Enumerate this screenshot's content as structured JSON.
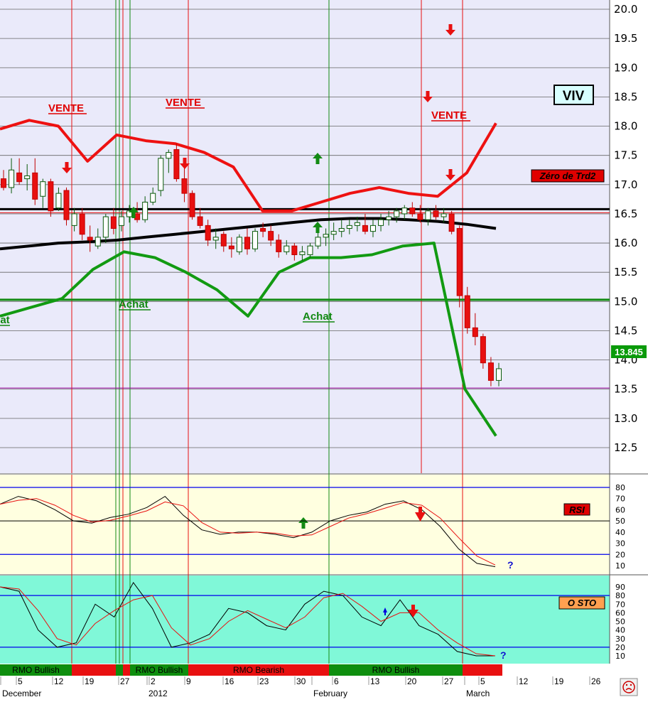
{
  "ticker": "VIV",
  "price_box": "13.845",
  "labels": {
    "vente": "VENTE",
    "achat": "Achat",
    "zero_trd2": "Zéro de Trd2",
    "rsi": "RSI",
    "osto": "O STO",
    "question": "?"
  },
  "colors": {
    "bullish": "#138a13",
    "bearish": "#e81010",
    "main_bg": "#eaeafa",
    "rsi_bg": "#ffffe0",
    "sto_bg": "#80f8d8"
  },
  "chart_data": [
    {
      "type": "candlestick",
      "title": "",
      "ylim": [
        12.1,
        20.2
      ],
      "ytick_labels": [
        "20.0",
        "19.5",
        "19.0",
        "18.5",
        "18.0",
        "17.5",
        "17.0",
        "16.5",
        "16.0",
        "15.5",
        "15.0",
        "14.5",
        "14.0",
        "13.5",
        "13.0",
        "12.5"
      ],
      "horizontal_levels": {
        "zero_trd2": 16.58,
        "support": 15.03,
        "low": 13.52
      },
      "candles": [
        [
          17.1,
          17.25,
          16.9,
          16.95
        ],
        [
          16.95,
          17.45,
          16.85,
          17.25
        ],
        [
          17.2,
          17.45,
          17.0,
          17.05
        ],
        [
          17.1,
          17.35,
          16.9,
          17.15
        ],
        [
          17.2,
          17.45,
          16.65,
          16.75
        ],
        [
          16.8,
          17.1,
          16.6,
          17.05
        ],
        [
          17.05,
          17.1,
          16.45,
          16.55
        ],
        [
          16.6,
          16.95,
          16.55,
          16.85
        ],
        [
          16.9,
          16.95,
          16.3,
          16.4
        ],
        [
          16.3,
          16.6,
          16.2,
          16.5
        ],
        [
          16.5,
          16.6,
          16.05,
          16.15
        ],
        [
          16.1,
          16.3,
          15.85,
          16.05
        ],
        [
          15.95,
          16.25,
          15.9,
          16.1
        ],
        [
          16.1,
          16.5,
          16.0,
          16.45
        ],
        [
          16.45,
          16.6,
          16.15,
          16.25
        ],
        [
          16.3,
          16.55,
          16.2,
          16.45
        ],
        [
          16.45,
          16.65,
          16.35,
          16.55
        ],
        [
          16.5,
          16.7,
          16.35,
          16.4
        ],
        [
          16.4,
          16.8,
          16.35,
          16.7
        ],
        [
          16.7,
          16.95,
          16.65,
          16.85
        ],
        [
          16.9,
          17.5,
          16.8,
          17.45
        ],
        [
          17.45,
          17.6,
          17.2,
          17.55
        ],
        [
          17.6,
          17.7,
          17.05,
          17.1
        ],
        [
          17.1,
          17.45,
          16.7,
          16.85
        ],
        [
          16.85,
          16.9,
          16.4,
          16.45
        ],
        [
          16.45,
          16.6,
          16.25,
          16.3
        ],
        [
          16.3,
          16.4,
          15.95,
          16.05
        ],
        [
          16.05,
          16.25,
          15.9,
          16.1
        ],
        [
          16.15,
          16.2,
          15.85,
          15.95
        ],
        [
          15.95,
          16.1,
          15.75,
          15.9
        ],
        [
          15.85,
          16.15,
          15.8,
          16.1
        ],
        [
          16.1,
          16.25,
          15.8,
          15.9
        ],
        [
          15.9,
          16.25,
          15.85,
          16.2
        ],
        [
          16.25,
          16.35,
          16.1,
          16.2
        ],
        [
          16.2,
          16.3,
          15.95,
          16.05
        ],
        [
          16.05,
          16.15,
          15.75,
          15.85
        ],
        [
          15.85,
          16.05,
          15.8,
          15.95
        ],
        [
          15.95,
          16.0,
          15.7,
          15.8
        ],
        [
          15.8,
          15.95,
          15.7,
          15.85
        ],
        [
          15.8,
          16.0,
          15.75,
          15.95
        ],
        [
          15.95,
          16.2,
          15.9,
          16.1
        ],
        [
          16.1,
          16.25,
          15.95,
          16.15
        ],
        [
          16.15,
          16.35,
          16.05,
          16.2
        ],
        [
          16.2,
          16.4,
          16.1,
          16.25
        ],
        [
          16.25,
          16.4,
          16.15,
          16.3
        ],
        [
          16.3,
          16.45,
          16.2,
          16.35
        ],
        [
          16.3,
          16.5,
          16.15,
          16.2
        ],
        [
          16.2,
          16.4,
          16.1,
          16.3
        ],
        [
          16.3,
          16.5,
          16.2,
          16.4
        ],
        [
          16.4,
          16.55,
          16.3,
          16.45
        ],
        [
          16.45,
          16.6,
          16.35,
          16.55
        ],
        [
          16.5,
          16.65,
          16.4,
          16.6
        ],
        [
          16.6,
          16.7,
          16.45,
          16.5
        ],
        [
          16.5,
          16.65,
          16.35,
          16.4
        ],
        [
          16.4,
          16.6,
          16.3,
          16.55
        ],
        [
          16.55,
          16.65,
          16.4,
          16.45
        ],
        [
          16.45,
          16.6,
          16.35,
          16.5
        ],
        [
          16.5,
          16.55,
          16.15,
          16.2
        ],
        [
          16.25,
          16.3,
          14.9,
          15.1
        ],
        [
          15.1,
          15.25,
          14.45,
          14.55
        ],
        [
          14.55,
          14.8,
          14.25,
          14.4
        ],
        [
          14.4,
          14.45,
          13.85,
          13.95
        ],
        [
          13.95,
          14.05,
          13.55,
          13.65
        ],
        [
          13.65,
          13.95,
          13.55,
          13.85
        ]
      ],
      "moving_avg_black": [
        15.9,
        15.95,
        16.0,
        16.02,
        16.05,
        16.1,
        16.15,
        16.2,
        16.25,
        16.3,
        16.35,
        16.4,
        16.42,
        16.42,
        16.4,
        16.37,
        16.32,
        16.25
      ],
      "series": [
        {
          "values": [
            17.95,
            18.1,
            18.0,
            17.4,
            17.85,
            17.75,
            17.7,
            17.55,
            17.3,
            16.55,
            16.55,
            16.7,
            16.85,
            16.95,
            16.85,
            16.8,
            17.2,
            18.05
          ]
        },
        {
          "values": [
            14.75,
            14.9,
            15.05,
            15.55,
            15.85,
            15.75,
            15.5,
            15.2,
            14.75,
            15.5,
            15.75,
            15.75,
            15.8,
            15.95,
            16.0,
            13.5,
            12.7
          ]
        }
      ],
      "signals": {
        "buy": [
          "Achat",
          "Achat"
        ],
        "sell": [
          "VENTE",
          "VENTE",
          "VENTE"
        ]
      }
    },
    {
      "type": "line",
      "title": "RSI",
      "ylim": [
        0,
        90
      ],
      "ytick_labels": [
        "80",
        "70",
        "60",
        "50",
        "40",
        "30",
        "20",
        "10"
      ],
      "reference_lines": [
        80,
        50,
        20
      ],
      "values": [
        65,
        72,
        68,
        60,
        50,
        48,
        53,
        56,
        62,
        72,
        55,
        42,
        38,
        40,
        40,
        38,
        35,
        40,
        50,
        55,
        58,
        65,
        68,
        60,
        45,
        25,
        12,
        9
      ]
    },
    {
      "type": "line",
      "title": "O STO",
      "ylim": [
        0,
        100
      ],
      "ytick_labels": [
        "90",
        "80",
        "70",
        "60",
        "50",
        "40",
        "30",
        "20",
        "10"
      ],
      "reference_lines": [
        80,
        20
      ],
      "values": [
        90,
        85,
        40,
        20,
        25,
        70,
        55,
        95,
        65,
        20,
        25,
        35,
        65,
        60,
        45,
        40,
        70,
        85,
        80,
        55,
        45,
        75,
        45,
        35,
        15,
        10,
        10
      ]
    }
  ],
  "rmo_segments": [
    {
      "label": "RMO Bullish",
      "state": "bullish"
    },
    {
      "label": "",
      "state": "bearish"
    },
    {
      "label": "",
      "state": "bullish"
    },
    {
      "label": "",
      "state": "bearish"
    },
    {
      "label": "RMO Bullish",
      "state": "bullish"
    },
    {
      "label": "RMO Bearish",
      "state": "bearish"
    },
    {
      "label": "RMO Bullish",
      "state": "bullish"
    },
    {
      "label": "",
      "state": "bearish"
    }
  ],
  "dates": [
    "December",
    "5",
    "12",
    "19",
    "27",
    "2012",
    "2",
    "9",
    "16",
    "23",
    "30",
    "February",
    "6",
    "13",
    "20",
    "27",
    "March",
    "5",
    "12",
    "19",
    "26"
  ]
}
